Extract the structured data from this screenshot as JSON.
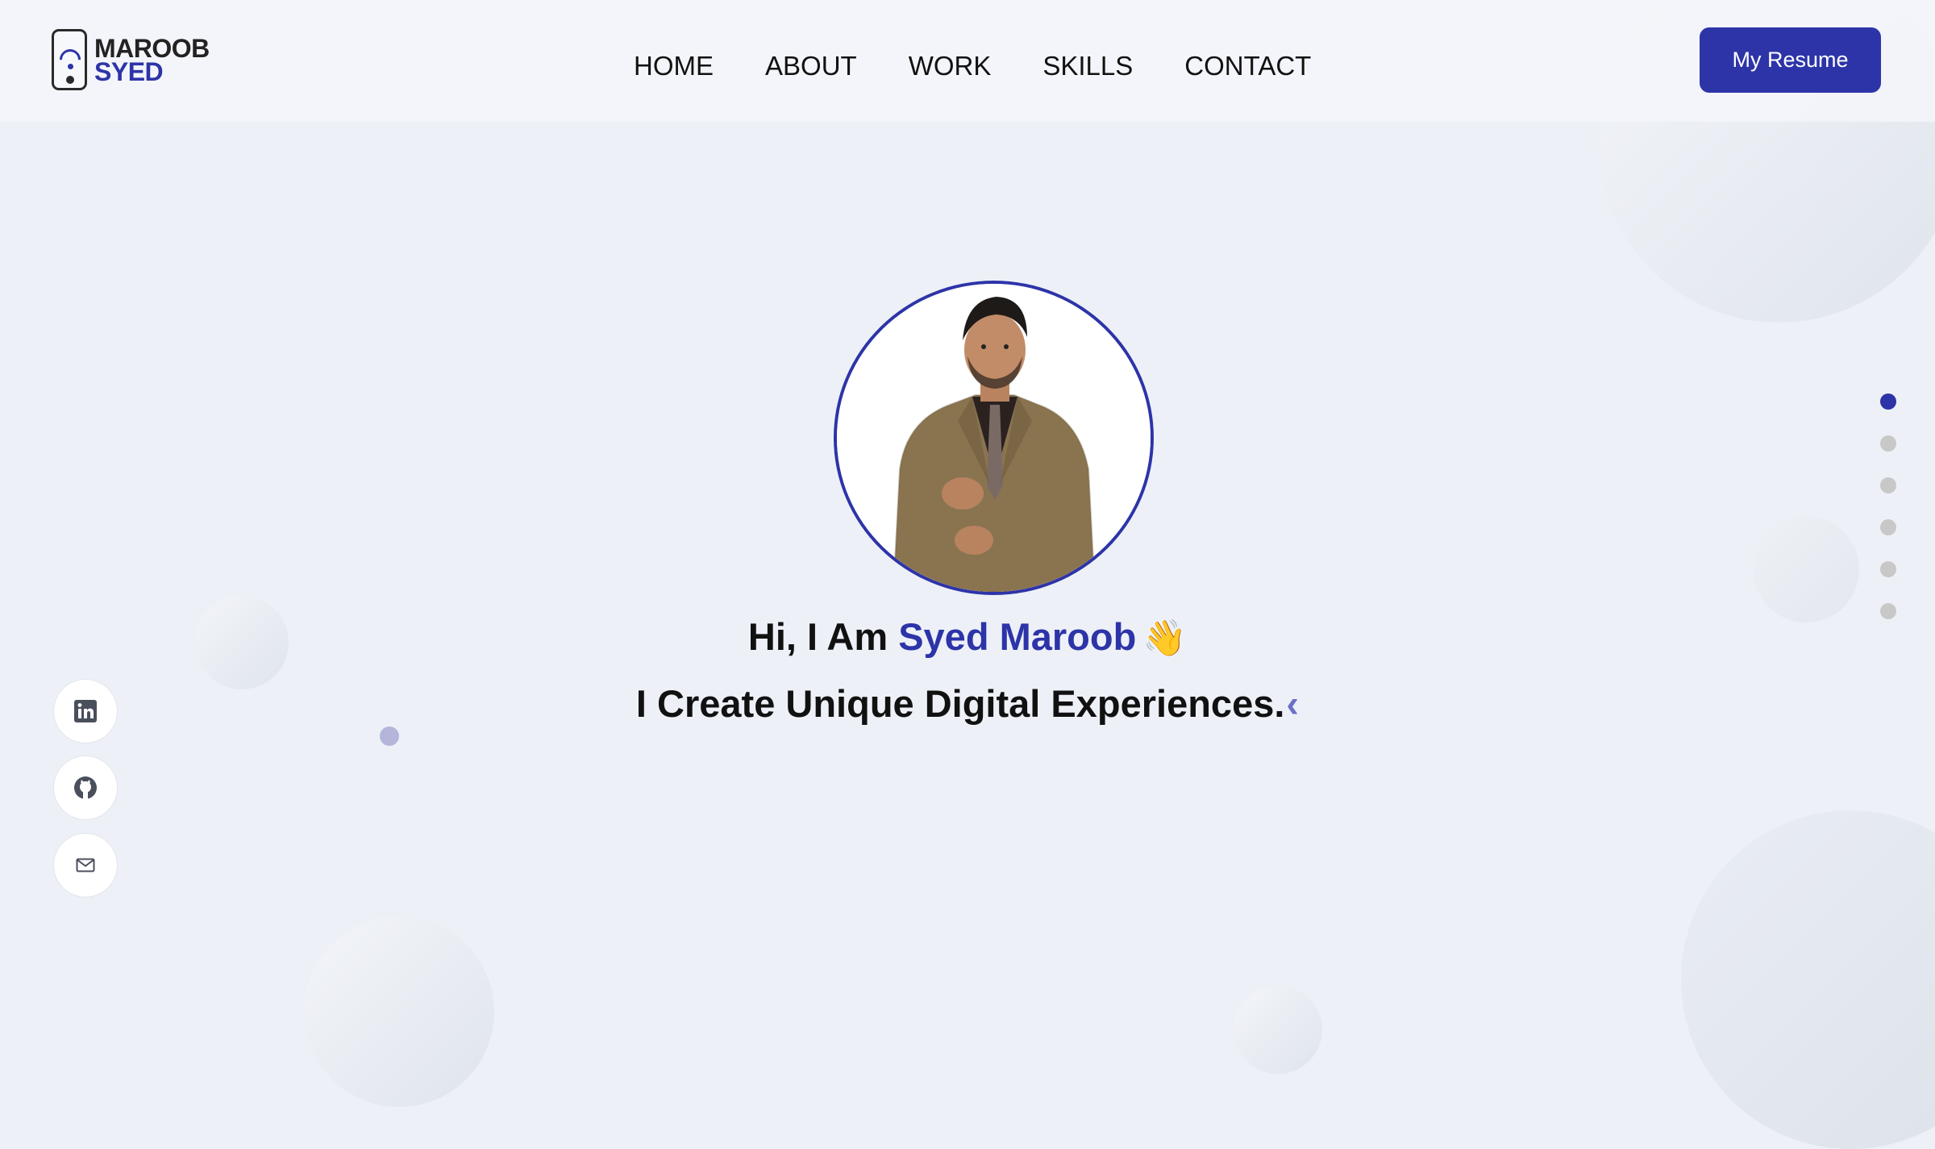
{
  "header": {
    "logo": {
      "line1": "MAROOB",
      "line2": "SYED"
    },
    "nav": [
      {
        "label": "HOME"
      },
      {
        "label": "ABOUT"
      },
      {
        "label": "WORK"
      },
      {
        "label": "SKILLS"
      },
      {
        "label": "CONTACT"
      }
    ],
    "resume_button": "My Resume"
  },
  "hero": {
    "greeting_prefix": "Hi, I Am ",
    "greeting_name": "Syed Maroob",
    "greeting_emoji": "👋",
    "tagline": "I Create Unique Digital Experiences.",
    "cursor": "‹"
  },
  "social": [
    {
      "icon": "linkedin-icon"
    },
    {
      "icon": "github-icon"
    },
    {
      "icon": "mail-icon"
    }
  ],
  "section_dots": {
    "count": 6,
    "active_index": 0
  },
  "colors": {
    "accent": "#2d34a8",
    "background": "#edf1f7",
    "text": "#111111",
    "dot_inactive": "#c8c8c8"
  }
}
